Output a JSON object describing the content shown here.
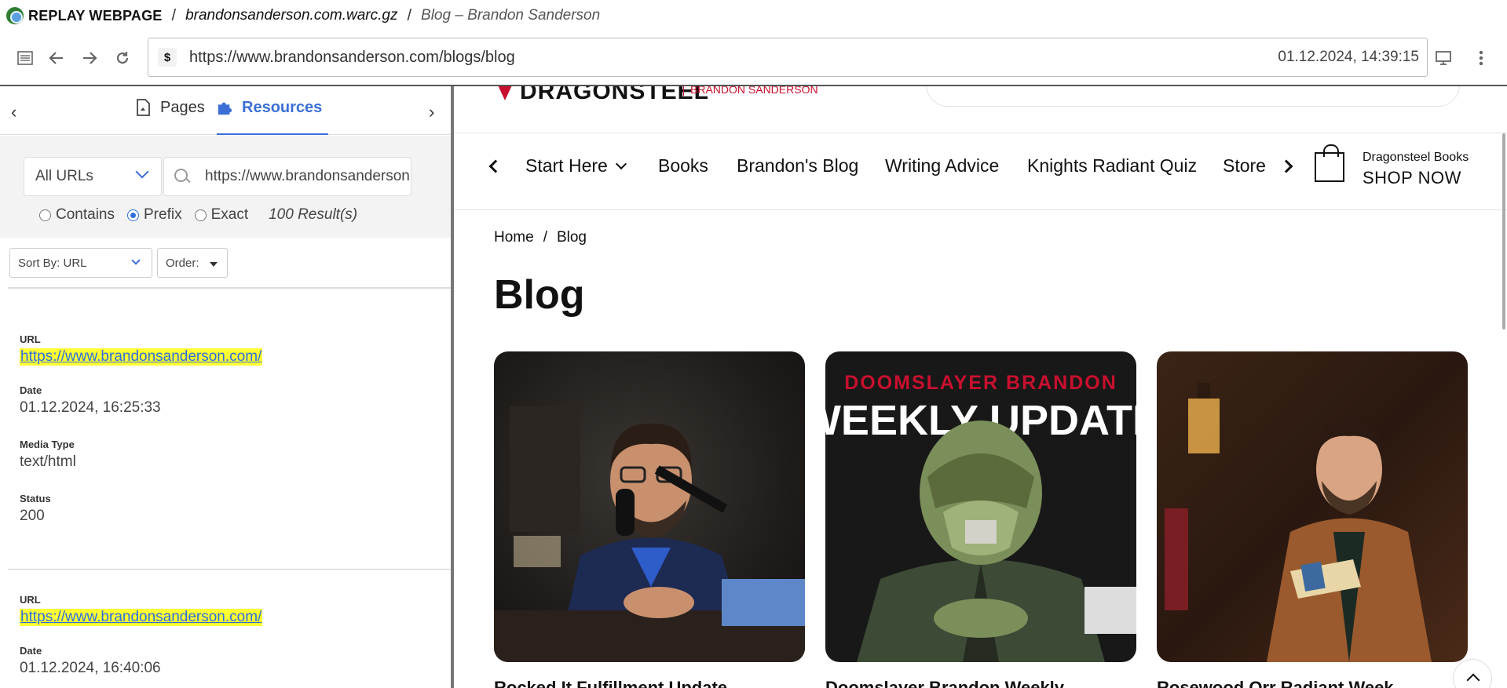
{
  "titlebar": {
    "brand": "REPLAY WEBPAGE",
    "archive": "brandonsanderson.com.warc.gz",
    "page": "Blog – Brandon Sanderson"
  },
  "toolbar": {
    "url": "https://www.brandonsanderson.com/blogs/blog",
    "timestamp": "01.12.2024, 14:39:15"
  },
  "sidebar": {
    "tabs": {
      "pages": "Pages",
      "resources": "Resources"
    },
    "url_scope": "All URLs",
    "search_value": "https://www.brandonsanderson.com/",
    "match": {
      "contains": "Contains",
      "prefix": "Prefix",
      "exact": "Exact"
    },
    "result_count": "100 Result(s)",
    "sort_label": "Sort By: URL",
    "order_label": "Order:",
    "field_labels": {
      "url": "URL",
      "date": "Date",
      "media_type": "Media Type",
      "status": "Status"
    },
    "records": [
      {
        "url": "https://www.brandonsanderson.com/",
        "date": "01.12.2024, 16:25:33",
        "media_type": "text/html",
        "status": "200"
      },
      {
        "url": "https://www.brandonsanderson.com/",
        "date": "01.12.2024, 16:40:06"
      }
    ]
  },
  "site": {
    "logo_text": "DRAGONSTEEL",
    "logo_sub": "BRANDON SANDERSON",
    "nav": [
      "Start Here",
      "Books",
      "Brandon's Blog",
      "Writing Advice",
      "Knights Radiant Quiz",
      "Store"
    ],
    "shop_small": "Dragonsteel Books",
    "shop_big": "SHOP NOW",
    "breadcrumb": {
      "home": "Home",
      "sep": "/",
      "current": "Blog"
    },
    "heading": "Blog",
    "cards": [
      {
        "title": "Rocked It Fulfillment Update"
      },
      {
        "overlay_top": "DOOMSLAYER BRANDON",
        "overlay_main": "WEEKLY UPDATE",
        "title": "Doomslayer Brandon Weekly"
      },
      {
        "title": "Rosewood Orr Radiant Week"
      }
    ]
  },
  "colors": {
    "accent": "#3b6fd6",
    "highlight": "#ffff33",
    "brand_red": "#c8102e"
  }
}
